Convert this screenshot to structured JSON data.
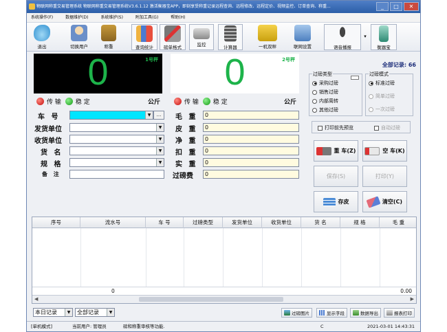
{
  "window": {
    "title": "物联网称重交易管理系统 物联网称重交易管理系统V3.6.1.12 激活衡器宝APP，即刻享受称重记录远程查询、远程修改、远程定价、视频监控、订单查询、称重..."
  },
  "menu": [
    "系统操作(F)",
    "数据维护(D)",
    "系统维护(S)",
    "附加工具(G)",
    "帮助(H)"
  ],
  "toolbar": {
    "exit": "退出",
    "switch_user": "切换用户",
    "weighing": "称重",
    "query_stats": "查询统计",
    "bill_format": "磅单格式",
    "monitor": "监控",
    "calculator": "计算器",
    "one_to_two": "一机双秤",
    "network_settings": "联网设置",
    "voice_broadcast": "语音播报",
    "scale_treasure": "衡器宝"
  },
  "scales": [
    {
      "label": "1号秤",
      "reading": "0",
      "unit": "公斤",
      "transfer": "传 输",
      "stable": "稳 定"
    },
    {
      "label": "2号秤",
      "reading": "0",
      "unit": "公斤",
      "transfer": "传 输",
      "stable": "稳 定"
    }
  ],
  "form": {
    "plate_label": "车 号",
    "sender_label": "发货单位",
    "receiver_label": "收货单位",
    "goods_label": "货 名",
    "spec_label": "规 格",
    "remark_label": "备 注",
    "ellipsis": "...",
    "gross_label": "毛 重",
    "tare_label": "皮 重",
    "net_label": "净 重",
    "deduct_label": "扣 重",
    "actual_label": "实 重",
    "fee_label": "过磅费",
    "gross": "0",
    "tare": "0",
    "net": "0",
    "deduct": "0",
    "actual": "0",
    "fee": "0"
  },
  "weigh_type": {
    "title": "过磅类型",
    "options": [
      "采购过磅",
      "销售过磅",
      "内部周转",
      "其他过磅"
    ],
    "selected": "采购过磅"
  },
  "weigh_mode": {
    "title": "过磅模式",
    "options": [
      "标准过磅",
      "简单过磅",
      "一次过磅"
    ],
    "selected": "标准过磅"
  },
  "total_records": "全部记录: 66",
  "checks": {
    "print_preview": "打印前先预览",
    "auto_weigh": "自动过磅"
  },
  "buttons": {
    "heavy": "重 车(Z)",
    "empty": "空 车(K)",
    "save": "保存(S)",
    "print": "打印(Y)",
    "save_tare": "存皮",
    "clear": "清空(C)"
  },
  "table": {
    "columns": [
      "序号",
      "流水号",
      "车 号",
      "过磅类型",
      "发货单位",
      "收货单位",
      "货 名",
      "规 格",
      "毛 重"
    ],
    "footer_count": "0",
    "footer_total": "0.00"
  },
  "footer": {
    "range_options": "本日记录",
    "filter_options": "全部记录",
    "weigh_image": "过磅图片",
    "show_fields": "显示字段",
    "export": "数据导出",
    "report_print": "报表打印"
  },
  "statusbar": {
    "mode": "[单机模式]",
    "user": "当前用户: 管理员",
    "hint": "磅和称重审核等功能.",
    "extra": "C",
    "datetime": "2021-03-01 14:43:31"
  },
  "colors": {
    "digit_green": "#1db34a",
    "plate_field": "#00e5ff",
    "title_blue": "#2c5fa8"
  }
}
